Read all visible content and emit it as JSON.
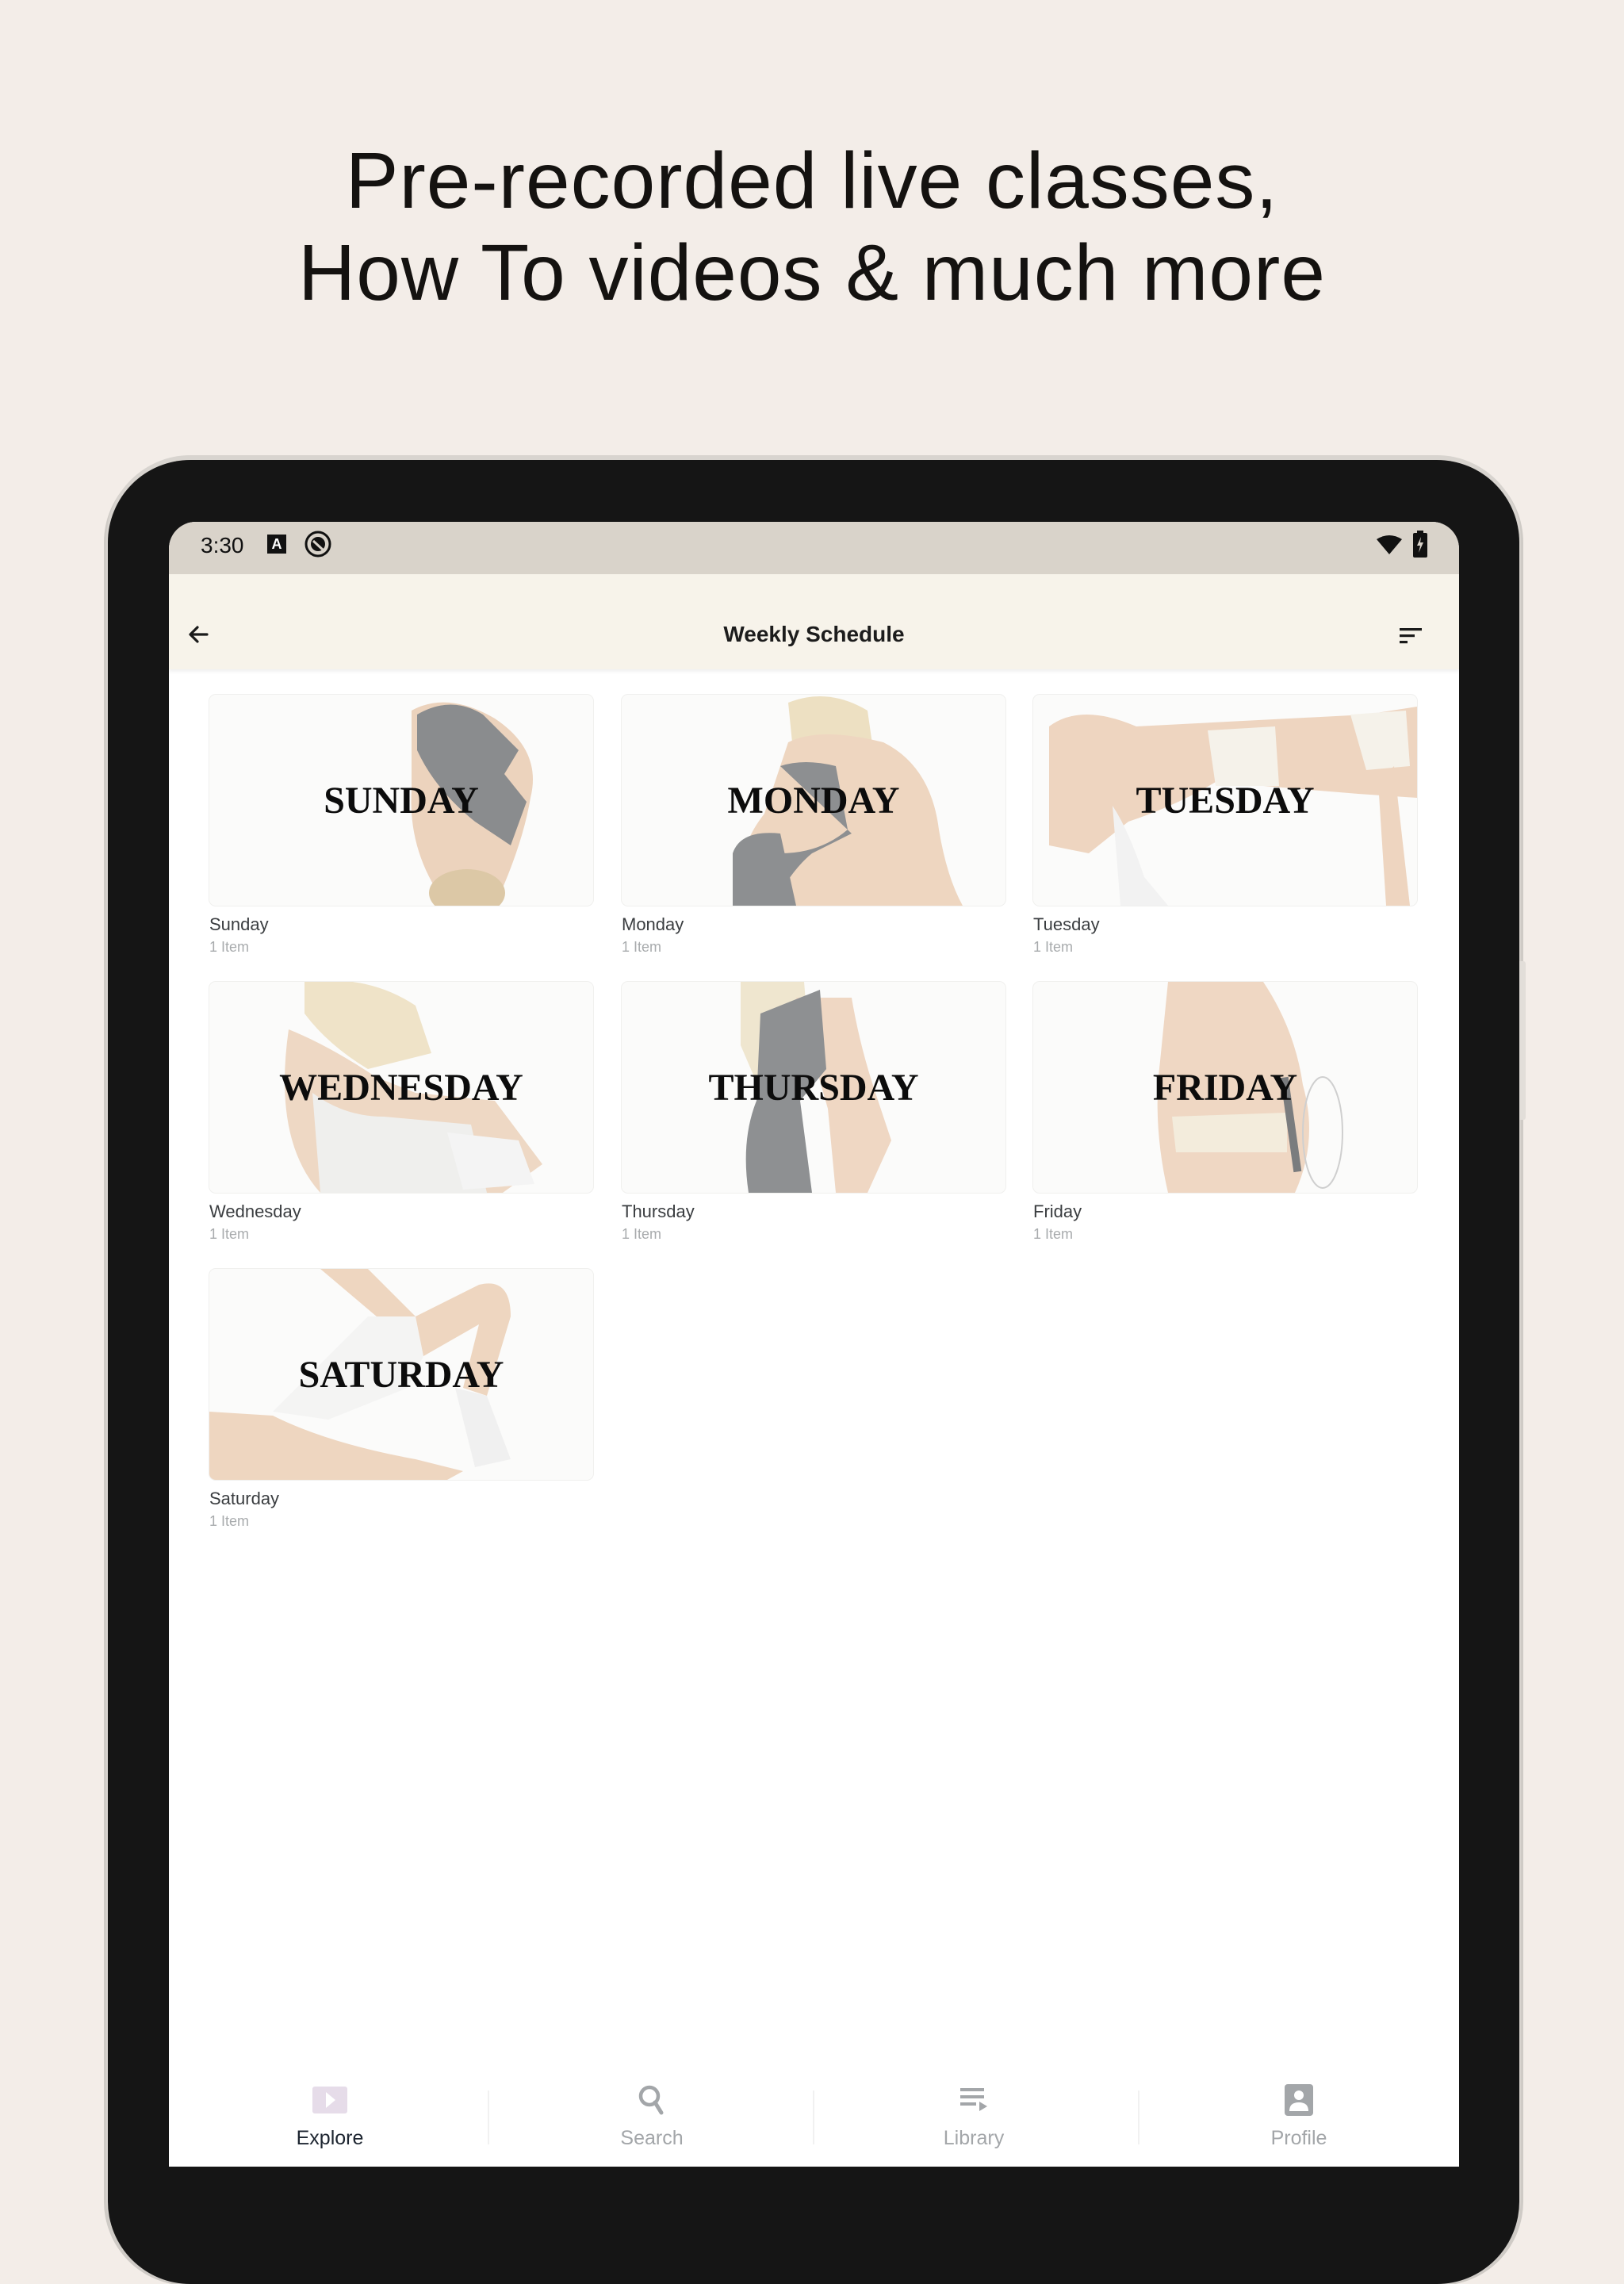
{
  "marketing": {
    "headline_line1": "Pre-recorded live classes,",
    "headline_line2": "How To videos & much more"
  },
  "status_bar": {
    "time": "3:30",
    "notification_icons": [
      "a-badge-icon",
      "circle-slash-icon"
    ],
    "system_icons": [
      "wifi-icon",
      "battery-charging-icon"
    ],
    "badge_letter": "A"
  },
  "app_bar": {
    "title": "Weekly Schedule",
    "back_icon": "arrow-left-icon",
    "sort_icon": "sort-icon"
  },
  "schedule": {
    "items": [
      {
        "thumb_label": "SUNDAY",
        "title": "Sunday",
        "subtitle": "1 Item"
      },
      {
        "thumb_label": "MONDAY",
        "title": "Monday",
        "subtitle": "1 Item"
      },
      {
        "thumb_label": "TUESDAY",
        "title": "Tuesday",
        "subtitle": "1 Item"
      },
      {
        "thumb_label": "WEDNESDAY",
        "title": "Wednesday",
        "subtitle": "1 Item"
      },
      {
        "thumb_label": "THURSDAY",
        "title": "Thursday",
        "subtitle": "1 Item"
      },
      {
        "thumb_label": "FRIDAY",
        "title": "Friday",
        "subtitle": "1 Item"
      },
      {
        "thumb_label": "SATURDAY",
        "title": "Saturday",
        "subtitle": "1 Item"
      }
    ]
  },
  "bottom_nav": {
    "items": [
      {
        "label": "Explore",
        "icon": "explore-play-icon",
        "active": true
      },
      {
        "label": "Search",
        "icon": "search-icon",
        "active": false
      },
      {
        "label": "Library",
        "icon": "library-playlist-icon",
        "active": false
      },
      {
        "label": "Profile",
        "icon": "profile-icon",
        "active": false
      }
    ]
  },
  "colors": {
    "page_background": "#f3ede8",
    "status_bar": "#d9d3ca",
    "app_bar": "#f7f3ea",
    "device_bezel": "#151515",
    "explore_icon_tint": "#e6dce9",
    "nav_inactive": "#a3a6a9",
    "nav_active_text": "#1d2530"
  }
}
